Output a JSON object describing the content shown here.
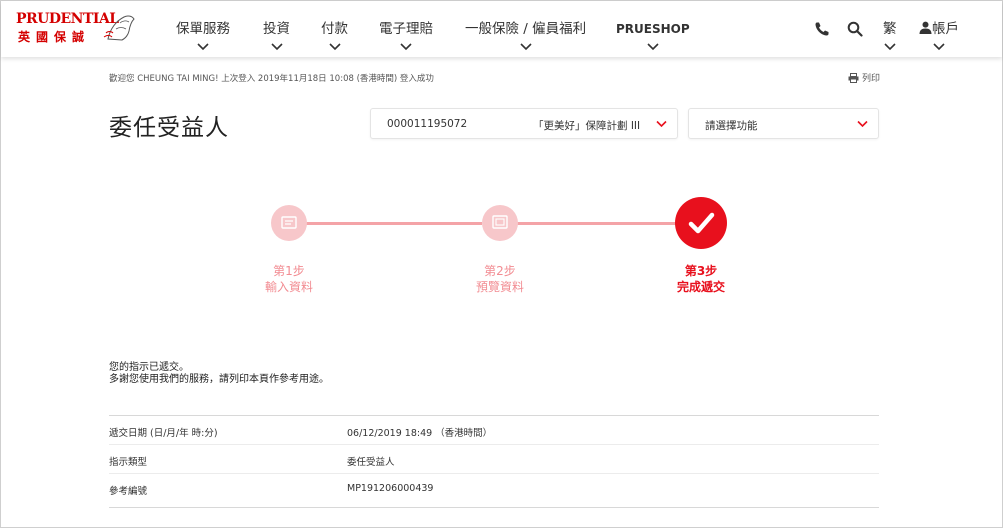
{
  "header": {
    "logo_text": "PRUDENTIAL",
    "logo_cn": "英國保誠",
    "nav": [
      {
        "label": "保單服務"
      },
      {
        "label": "投資"
      },
      {
        "label": "付款"
      },
      {
        "label": "電子理賠"
      },
      {
        "label": "一般保險 / 僱員福利"
      },
      {
        "label": "PRUESHOP"
      }
    ],
    "language_label": "繁",
    "account_label": "帳戶",
    "icons": [
      "phone-icon",
      "search-icon",
      "user-icon"
    ]
  },
  "welcome_text": "歡迎您 CHEUNG TAI MING! 上次登入 2019年11月18日 10:08 (香港時間) 登入成功",
  "print_label": "列印",
  "page_title": "委任受益人",
  "policy_select": {
    "number": "000011195072",
    "name": "「更美好」保障計劃 III"
  },
  "function_select": {
    "placeholder": "請選擇功能"
  },
  "steps": [
    {
      "step": "第1步",
      "label": "輸入資料",
      "state": "done",
      "icon": "document-icon"
    },
    {
      "step": "第2步",
      "label": "預覽資料",
      "state": "done",
      "icon": "preview-icon"
    },
    {
      "step": "第3步",
      "label": "完成遞交",
      "state": "current",
      "icon": "check-icon"
    }
  ],
  "message": {
    "line1": "您的指示已遞交。",
    "line2": "多謝您使用我們的服務，請列印本頁作參考用途。"
  },
  "details": [
    {
      "label": "遞交日期 (日/月/年 時:分)",
      "value": "06/12/2019 18:49 （香港時間）"
    },
    {
      "label": "指示類型",
      "value": "委任受益人"
    },
    {
      "label": "參考編號",
      "value": "MP191206000439"
    }
  ],
  "colors": {
    "brand_red": "#e8101d",
    "step_inactive": "#f7c7ca",
    "step_text_inactive": "#f28c92"
  }
}
